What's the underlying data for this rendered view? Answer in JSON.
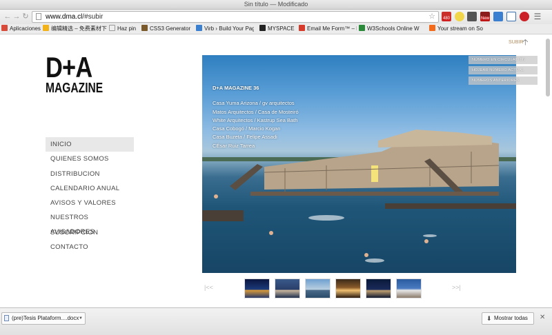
{
  "window": {
    "title": "Sin título — Modificado"
  },
  "toolbar": {
    "url_host": "www.dma.cl",
    "url_path": "/#subir",
    "badge_480": "480",
    "badge_new": "New"
  },
  "bookmarks": [
    {
      "label": "Aplicaciones",
      "color": "#d84a3a"
    },
    {
      "label": "编辑精选 – 免费素材下",
      "color": "#f2b21a"
    },
    {
      "label": "Haz pin",
      "color": "#eeeeee"
    },
    {
      "label": "CSS3 Generator",
      "color": "#7a5a2a"
    },
    {
      "label": "Virb › Build Your Pag",
      "color": "#3a7fd0"
    },
    {
      "label": "MYSPACE",
      "color": "#222222"
    },
    {
      "label": "Email Me Form™ – H",
      "color": "#d63a2a"
    },
    {
      "label": "W3Schools Online W",
      "color": "#2a8a3a"
    },
    {
      "label": "Your stream on Sou",
      "color": "#f26a1a"
    }
  ],
  "site": {
    "logo_line1": "D+A",
    "logo_line2": "MAGAZINE",
    "subir": "SUBIR",
    "menu": [
      {
        "label": "INICIO",
        "active": true
      },
      {
        "label": "QUIENES SOMOS"
      },
      {
        "label": "DISTRIBUCION"
      },
      {
        "label": "CALENDARIO ANUAL"
      },
      {
        "label": "AVISOS Y VALORES"
      },
      {
        "label": "NUESTROS AVISADORES"
      },
      {
        "label": "SUSCRIPCION"
      },
      {
        "label": "CONTACTO"
      }
    ],
    "hero": {
      "issue": "D+A MAGAZINE 36",
      "items": [
        "Casa Yuma Arizona / gv arquitectos",
        "Matos Arquitectos / Casa de Mosteiró",
        "White Arquitectos / Kastrup Sea Bath",
        "Casa Cobogó / Marcio Kogan",
        "Casa Buzeta / Felipe Assadi",
        "CÉsar Ruiz Tarrea"
      ]
    },
    "tabs": [
      "NÚMERO EN CIRCULACIÓN",
      "HOJEAR NÚMERO ACTUAL",
      "NÚMEROS ANTERIORES"
    ],
    "pager": {
      "prev": "|<<",
      "next": ">>|"
    },
    "thumbnails": 6
  },
  "downloads": {
    "file": "(pre)Tesis Plataform....docx",
    "show_all": "Mostrar todas"
  }
}
